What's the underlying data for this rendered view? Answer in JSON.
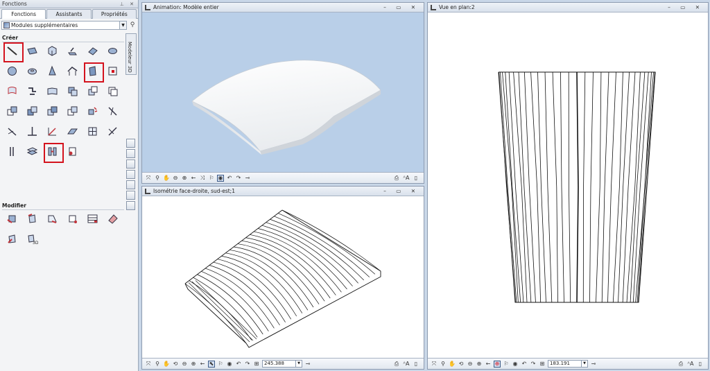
{
  "panel": {
    "title": "Fonctions",
    "controls": "⊥ ✕",
    "tabs": [
      {
        "label": "Fonctions",
        "active": true
      },
      {
        "label": "Assistants",
        "active": false
      },
      {
        "label": "Propriétés",
        "active": false
      }
    ],
    "module_select": "Modules supplémentaires",
    "vertical_tab": "Modeleur 3D",
    "sections": {
      "create": "Créer",
      "modify": "Modifier"
    }
  },
  "windows": {
    "animation": {
      "title": "Animation: Modèle entier",
      "controls": "– ▭ ✕"
    },
    "isometric": {
      "title": "Isométrie face-droite, sud-est;1",
      "controls": "– ▭ ✕",
      "scale_value": "245.388"
    },
    "plan": {
      "title": "Vue en plan:2",
      "controls": "– ▭ ✕",
      "scale_value": "183.191"
    }
  },
  "colors": {
    "highlight": "#d4121d",
    "animation_bg": "#b9cfe8",
    "frame_bg": "#c9d7e8"
  }
}
